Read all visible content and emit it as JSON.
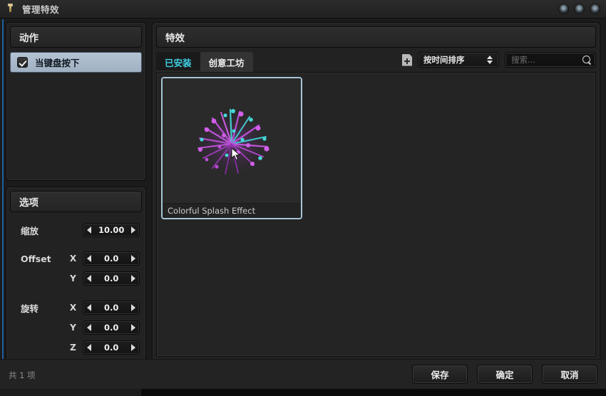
{
  "window": {
    "title": "管理特效",
    "icon": "pin-icon",
    "buttons": [
      {
        "name": "minimize-button",
        "icon": "circle-button"
      },
      {
        "name": "maximize-button",
        "icon": "circle-button"
      },
      {
        "name": "close-button",
        "icon": "circle-button"
      }
    ]
  },
  "action_panel": {
    "header": "动作",
    "items": [
      {
        "label": "当键盘按下",
        "checked": true
      }
    ]
  },
  "options_panel": {
    "header": "选项",
    "rows": [
      {
        "label": "缩放",
        "axis": "",
        "value": "10.00"
      },
      {
        "label": "Offset",
        "axis": "X",
        "value": "0.0"
      },
      {
        "label": "",
        "axis": "Y",
        "value": "0.0"
      },
      {
        "label": "旋转",
        "axis": "X",
        "value": "0.0"
      },
      {
        "label": "",
        "axis": "Y",
        "value": "0.0"
      },
      {
        "label": "",
        "axis": "Z",
        "value": "0.0"
      }
    ]
  },
  "effects_panel": {
    "header": "特效",
    "tabs": [
      {
        "label": "已安装",
        "active": true
      },
      {
        "label": "创意工坊",
        "active": false
      }
    ],
    "import_icon": "file-add-icon",
    "sort": {
      "selected": "按时间排序",
      "stepper_icon": "up-down-arrows-icon"
    },
    "search": {
      "value": "",
      "placeholder": "搜索...",
      "icon": "search-icon"
    },
    "cards": [
      {
        "title": "Colorful Splash Effect",
        "thumbnail": "purple-cyan-particle-burst",
        "selected": true
      }
    ]
  },
  "footer": {
    "count": "共 1 项",
    "buttons": [
      {
        "name": "save-button",
        "label": "保存"
      },
      {
        "name": "ok-button",
        "label": "确定"
      },
      {
        "name": "cancel-button",
        "label": "取消"
      }
    ]
  },
  "colors": {
    "accent_blue": "#1d5f9e",
    "tab_active_text": "#3fd0e6",
    "selection_border": "#a6c4d6",
    "selected_row_bg": "#a9b9cb",
    "particle_magenta": "#c050d8",
    "particle_cyan": "#46d7d7"
  }
}
